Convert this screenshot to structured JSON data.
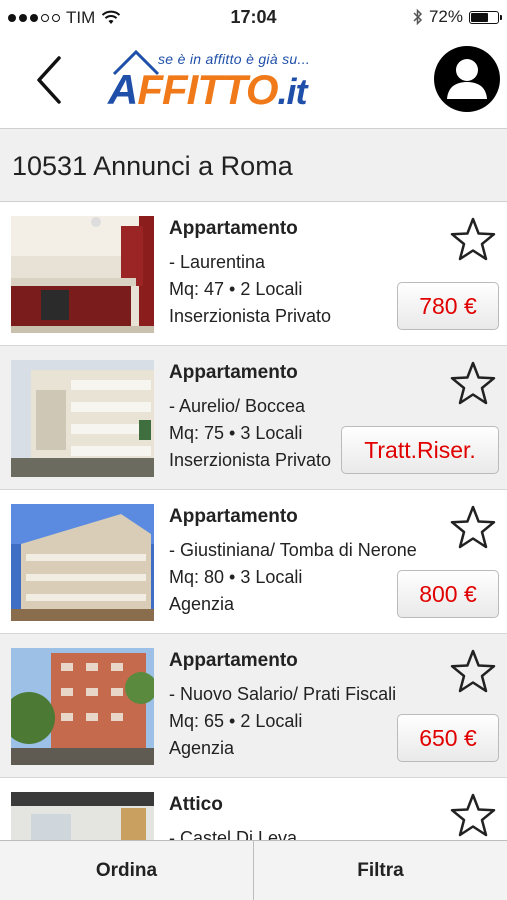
{
  "status_bar": {
    "carrier": "TIM",
    "signal_strength": 3,
    "signal_max": 5,
    "time": "17:04",
    "battery": "72%",
    "battery_level": 0.72
  },
  "header": {
    "back_icon": "chevron-left-icon",
    "logo_slogan": "se è in affitto è già su...",
    "logo_word_a": "A",
    "logo_word_ffitto": "FFITTO",
    "logo_word_it": ".it",
    "profile_icon": "user-icon"
  },
  "results": {
    "title": "10531 Annunci a Roma"
  },
  "listings": [
    {
      "type": "Appartamento",
      "zone": "- Laurentina",
      "size": "Mq: 47 • 2 Locali",
      "advertiser": "Inserzionista Privato",
      "price": "780 €"
    },
    {
      "type": "Appartamento",
      "zone": "- Aurelio/ Boccea",
      "size": "Mq: 75 • 3 Locali",
      "advertiser": "Inserzionista Privato",
      "price": "Tratt.Riser."
    },
    {
      "type": "Appartamento",
      "zone": "- Giustiniana/ Tomba di Nerone",
      "size": "Mq: 80 • 3 Locali",
      "advertiser": "Agenzia",
      "price": "800 €"
    },
    {
      "type": "Appartamento",
      "zone": "- Nuovo Salario/ Prati Fiscali",
      "size": "Mq: 65 • 2 Locali",
      "advertiser": "Agenzia",
      "price": "650 €"
    },
    {
      "type": "Attico",
      "zone": "- Castel Di Leva",
      "size": "",
      "advertiser": "",
      "price": ""
    }
  ],
  "bottom_bar": {
    "sort_label": "Ordina",
    "filter_label": "Filtra"
  },
  "colors": {
    "price_text": "#e10000",
    "logo_blue": "#1f4fa8",
    "logo_orange": "#f07a1a"
  }
}
